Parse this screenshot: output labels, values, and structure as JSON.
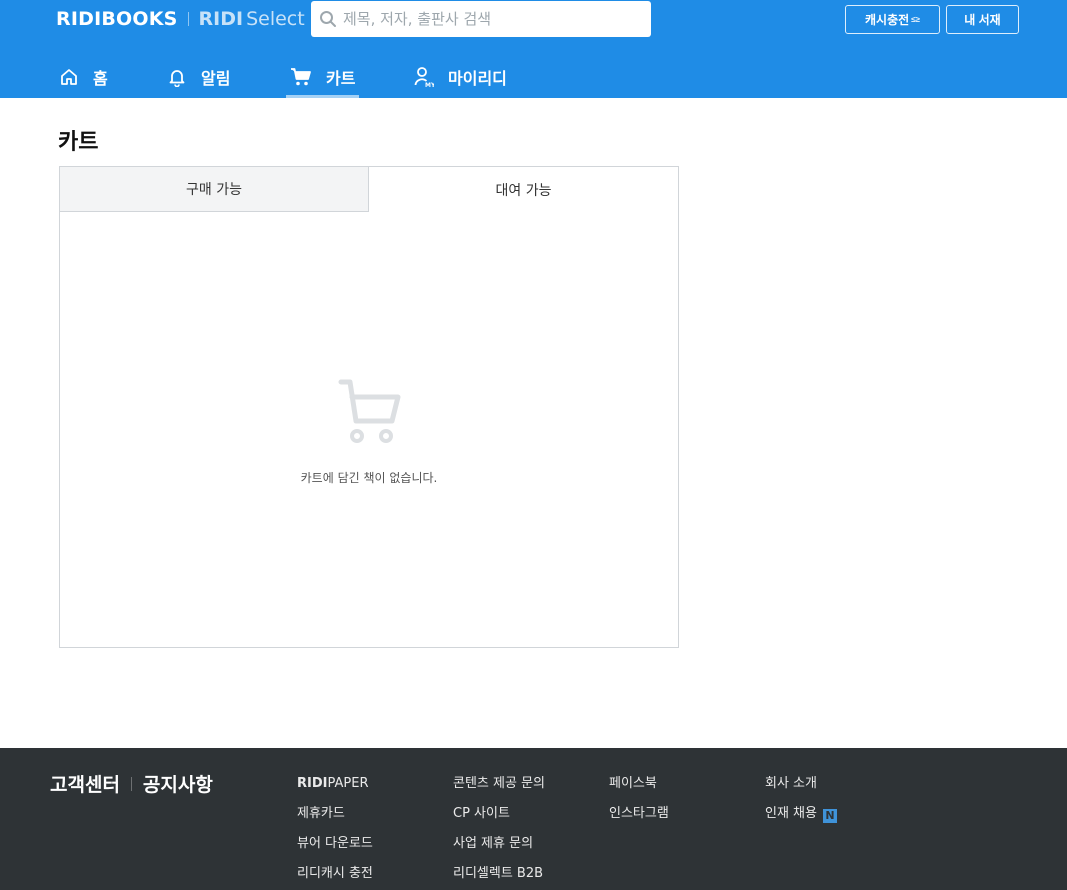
{
  "header": {
    "brand_main": "RIDIBOOKS",
    "brand_select_bold": "RIDI",
    "brand_select_light": "Select",
    "search_placeholder": "제목, 저자, 출판사 검색",
    "cash_button_label": "캐시충전",
    "cash_button_mark": "≤≥",
    "library_button_label": "내 서재",
    "accent_color": "#1f8ce6"
  },
  "gnb": {
    "items": [
      {
        "label": "홈",
        "icon": "home-icon"
      },
      {
        "label": "알림",
        "icon": "bell-icon"
      },
      {
        "label": "카트",
        "icon": "cart-icon",
        "active": true
      },
      {
        "label": "마이리디",
        "icon": "my-icon",
        "icon_text": "MY"
      }
    ]
  },
  "main": {
    "title": "카트",
    "tabs": [
      {
        "label": "구매 가능"
      },
      {
        "label": "대여 가능",
        "selected": true
      }
    ],
    "empty_message": "카트에 담긴 책이 없습니다."
  },
  "footer": {
    "primary_links": [
      "고객센터",
      "공지사항"
    ],
    "columns": [
      {
        "links": [
          "PAPER",
          "제휴카드",
          "뷰어 다운로드",
          "리디캐시 충전"
        ],
        "brand_bold": "RIDI"
      },
      {
        "links": [
          "콘텐츠 제공 문의",
          "CP 사이트",
          "사업 제휴 문의",
          "리디셀렉트 B2B"
        ]
      },
      {
        "links": [
          "페이스북",
          "인스타그램"
        ]
      },
      {
        "links": [
          "회사 소개",
          "인재 채용"
        ],
        "badge": "N"
      }
    ],
    "background": "#2e3336"
  }
}
